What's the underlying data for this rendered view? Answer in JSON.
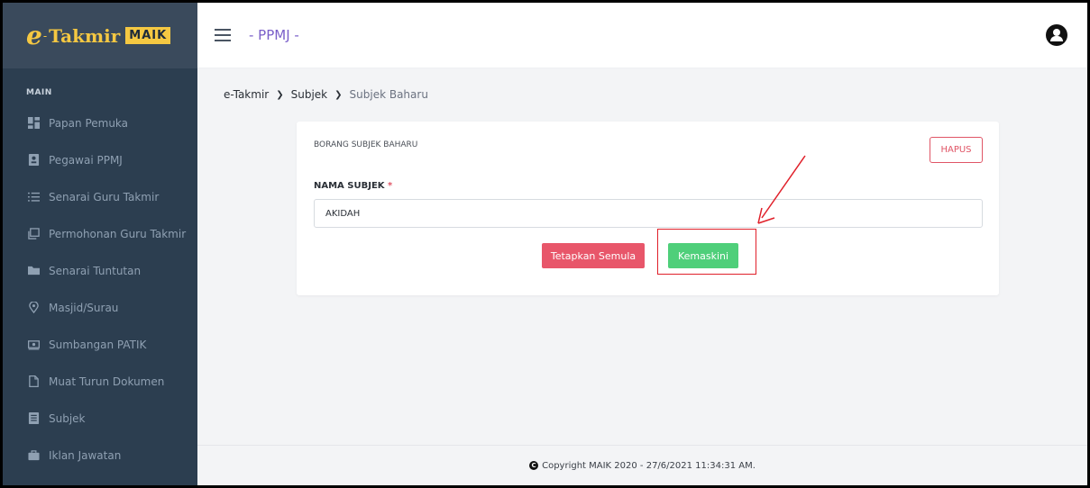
{
  "app": {
    "logo_script": "e",
    "logo_dash": "-",
    "logo_name": "Takmir",
    "logo_brand": "MAIK",
    "page_title": "- PPMJ -"
  },
  "sidebar": {
    "section": "MAIN",
    "items": [
      {
        "label": "Papan Pemuka",
        "icon": "dashboard-icon"
      },
      {
        "label": "Pegawai PPMJ",
        "icon": "id-card-icon"
      },
      {
        "label": "Senarai Guru Takmir",
        "icon": "list-icon"
      },
      {
        "label": "Permohonan Guru Takmir",
        "icon": "copy-icon"
      },
      {
        "label": "Senarai Tuntutan",
        "icon": "folder-icon"
      },
      {
        "label": "Masjid/Surau",
        "icon": "map-pin-icon"
      },
      {
        "label": "Sumbangan PATIK",
        "icon": "money-icon"
      },
      {
        "label": "Muat Turun Dokumen",
        "icon": "file-icon"
      },
      {
        "label": "Subjek",
        "icon": "book-icon"
      },
      {
        "label": "Iklan Jawatan",
        "icon": "briefcase-icon"
      }
    ]
  },
  "breadcrumb": {
    "items": [
      "e-Takmir",
      "Subjek",
      "Subjek Baharu"
    ]
  },
  "form": {
    "title": "BORANG SUBJEK BAHARU",
    "delete_label": "HAPUS",
    "field_label": "NAMA SUBJEK",
    "required_mark": "*",
    "field_value": "AKIDAH",
    "reset_label": "Tetapkan Semula",
    "update_label": "Kemaskini"
  },
  "footer": {
    "text": "Copyright MAIK 2020 - 27/6/2021 11:34:31 AM."
  },
  "colors": {
    "sidebar_bg": "#2c3e50",
    "accent_title": "#7a5fc9",
    "danger": "#e8566a",
    "success": "#4fcf7a",
    "annotation": "#e0202a"
  }
}
